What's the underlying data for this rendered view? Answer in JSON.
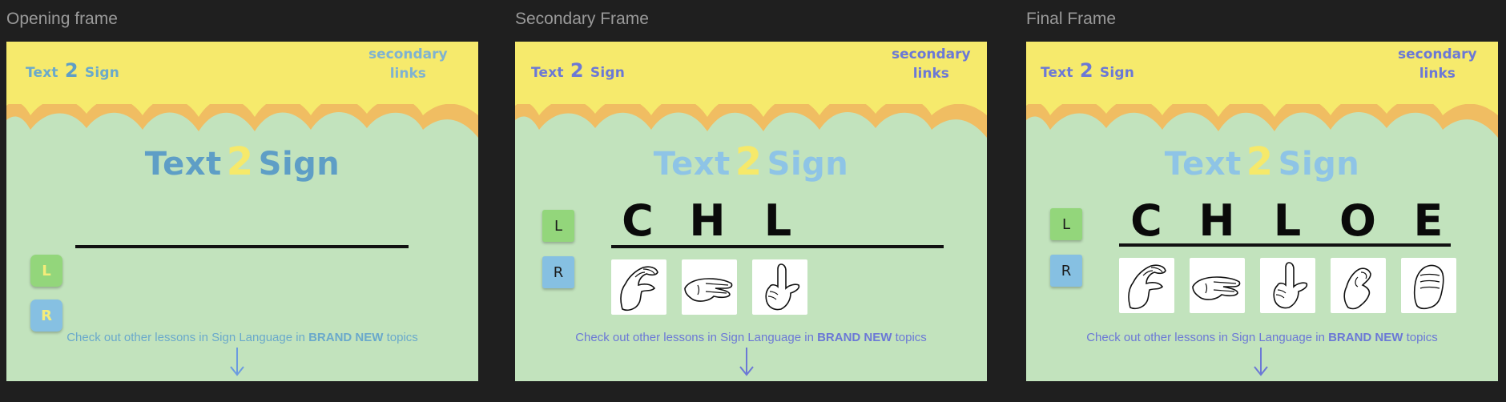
{
  "frames": [
    {
      "label": "Opening frame",
      "brand": {
        "pre": "Text",
        "num": "2",
        "post": "Sign"
      },
      "secondary_links": [
        "secondary",
        "links"
      ],
      "title": {
        "pre": "Text",
        "num": "2",
        "post": "Sign"
      },
      "left_label": "L",
      "right_label": "R",
      "letters": [],
      "signs": [],
      "cta": {
        "pre": "Check out other lessons in Sign Language in",
        "bold": "BRAND NEW",
        "post": "topics"
      }
    },
    {
      "label": "Secondary Frame",
      "brand": {
        "pre": "Text",
        "num": "2",
        "post": "Sign"
      },
      "secondary_links": [
        "secondary",
        "links"
      ],
      "title": {
        "pre": "Text",
        "num": "2",
        "post": "Sign"
      },
      "left_label": "L",
      "right_label": "R",
      "letters": [
        "C",
        "H",
        "L"
      ],
      "signs": [
        "hand-sign-c-icon",
        "hand-sign-h-icon",
        "hand-sign-l-icon"
      ],
      "cta": {
        "pre": "Check out other lessons in Sign Language in",
        "bold": "BRAND NEW",
        "post": "topics"
      }
    },
    {
      "label": "Final Frame",
      "brand": {
        "pre": "Text",
        "num": "2",
        "post": "Sign"
      },
      "secondary_links": [
        "secondary",
        "links"
      ],
      "title": {
        "pre": "Text",
        "num": "2",
        "post": "Sign"
      },
      "left_label": "L",
      "right_label": "R",
      "letters": [
        "C",
        "H",
        "L",
        "O",
        "E"
      ],
      "signs": [
        "hand-sign-c-icon",
        "hand-sign-h-icon",
        "hand-sign-l-icon",
        "hand-sign-o-icon",
        "hand-sign-e-icon"
      ],
      "cta": {
        "pre": "Check out other lessons in Sign Language in",
        "bold": "BRAND NEW",
        "post": "topics"
      }
    }
  ],
  "colors": {
    "background": "#1f1f1f",
    "frame_bg": "#c2e3bd",
    "header_yellow": "#f6ea6c",
    "header_orange": "#f0bd62",
    "accent_blue": "#6b78d6",
    "title_blue": "#5e9ec6",
    "title_two": "#f6e96a",
    "left_button": "#93d67b",
    "right_button": "#86c0e2"
  }
}
